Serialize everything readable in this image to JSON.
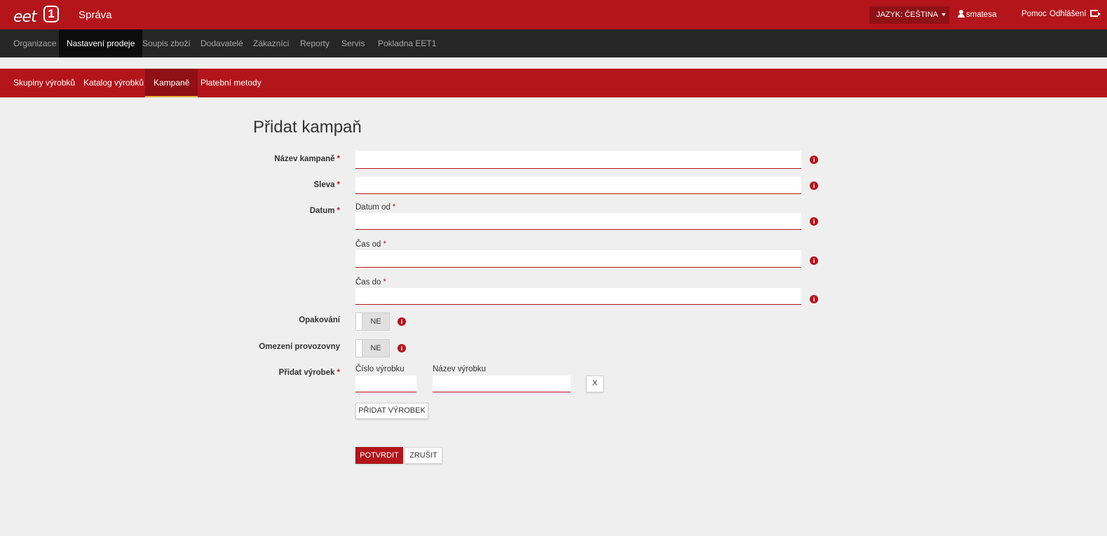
{
  "header": {
    "logo_text": "eet",
    "logo_badge": "1",
    "app_title": "Správa",
    "language_button": "JAZYK: ČEŠTINA",
    "user_name": "smatesa",
    "help_link": "Pomoc",
    "logout_link": "Odhlášení"
  },
  "main_nav": {
    "items": [
      {
        "label": "Organizace",
        "active": false
      },
      {
        "label": "Nastavení prodeje",
        "active": true
      },
      {
        "label": "Soupis zboží",
        "active": false
      },
      {
        "label": "Dodavatelé",
        "active": false
      },
      {
        "label": "Zákazníci",
        "active": false
      },
      {
        "label": "Reporty",
        "active": false
      },
      {
        "label": "Servis",
        "active": false
      },
      {
        "label": "Pokladna EET1",
        "active": false
      }
    ]
  },
  "sub_nav": {
    "items": [
      {
        "label": "Skupiny výrobků",
        "active": false
      },
      {
        "label": "Katalog výrobků",
        "active": false
      },
      {
        "label": "Kampaně",
        "active": true
      },
      {
        "label": "Platební metody",
        "active": false
      }
    ]
  },
  "form": {
    "title": "Přidat kampaň",
    "required_mark": "*",
    "campaign_name": {
      "label": "Název kampaně",
      "value": ""
    },
    "discount": {
      "label": "Sleva",
      "value": ""
    },
    "date": {
      "label": "Datum",
      "date_from": {
        "label": "Datum od",
        "value": ""
      },
      "time_from": {
        "label": "Čas od",
        "value": ""
      },
      "time_to": {
        "label": "Čas do",
        "value": ""
      }
    },
    "repeat": {
      "label": "Opakování",
      "toggle_text": "NE"
    },
    "store_limit": {
      "label": "Omezení provozovny",
      "toggle_text": "NE"
    },
    "add_product": {
      "label": "Přidat výrobek",
      "product_number": {
        "label": "Číslo výrobku",
        "value": ""
      },
      "product_name": {
        "label": "Název výrobku",
        "value": ""
      },
      "remove_label": "X",
      "add_button": "PŘIDAT VÝROBEK"
    },
    "confirm_button": "POTVRDIT",
    "cancel_button": "ZRUŠIT",
    "info_icon_glyph": "i"
  }
}
